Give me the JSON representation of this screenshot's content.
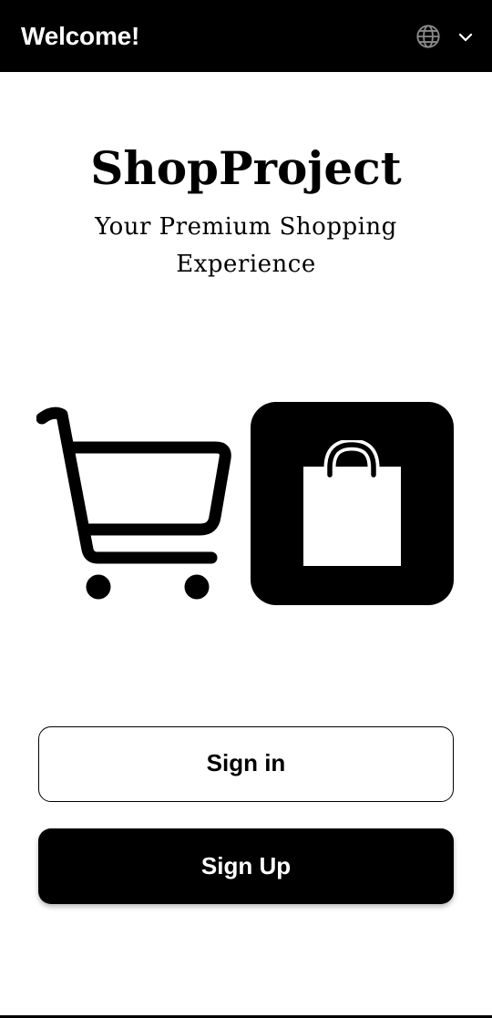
{
  "app_bar": {
    "title": "Welcome!",
    "language_icon": "globe-icon",
    "dropdown_icon": "chevron-down-icon",
    "background": "#000000",
    "text_color": "#ffffff"
  },
  "brand": {
    "name": "ShopProject",
    "tagline": "Your Premium Shopping Experience"
  },
  "illustrations": {
    "left": "shopping-cart-icon",
    "right": "shopping-bag-icon"
  },
  "actions": {
    "sign_in_label": "Sign in",
    "sign_up_label": "Sign Up"
  },
  "colors": {
    "primary": "#000000",
    "surface": "#ffffff"
  }
}
